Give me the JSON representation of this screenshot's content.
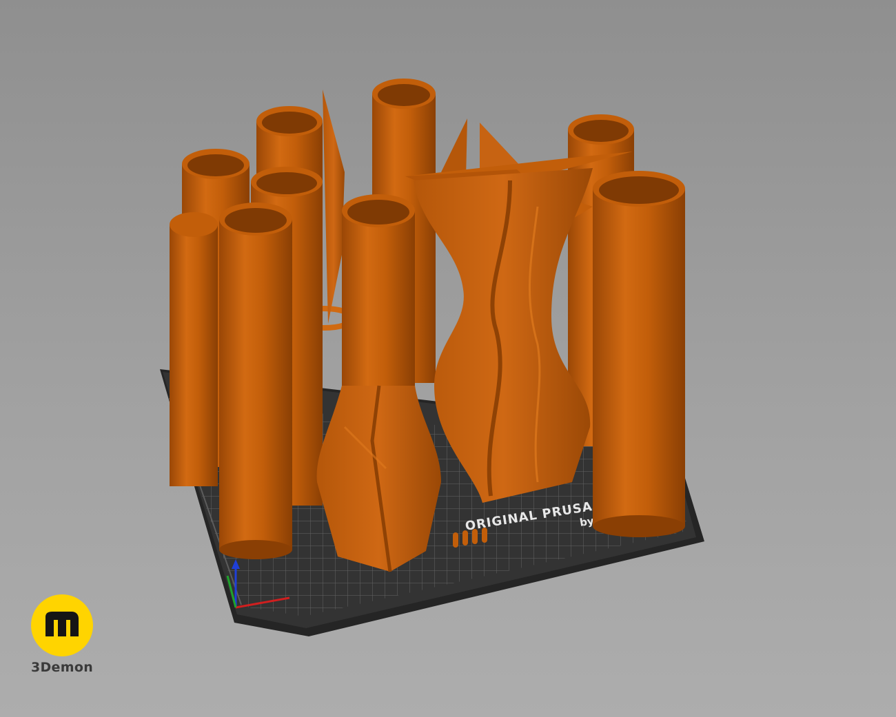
{
  "viewport": {
    "background_color": "#9b9b9b",
    "model_color": "#c25e0a",
    "model_shadow_color": "#8f4205",
    "model_light_color": "#e07a1e",
    "bed_color": "#2e2e2e"
  },
  "bed": {
    "logo_text": "ORIGINAL PRUSA",
    "logo_subtext": "by"
  },
  "watermark": {
    "icon": "m-logo-icon",
    "badge_color": "#ffd400",
    "brand": "3Demon"
  }
}
